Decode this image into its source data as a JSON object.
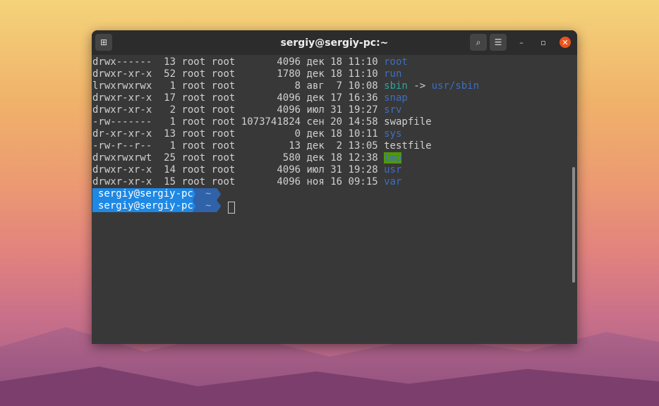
{
  "window": {
    "title": "sergiy@sergiy-pc:~"
  },
  "listing": [
    {
      "perms": "drwx------",
      "links": "13",
      "owner": "root",
      "group": "root",
      "size": "4096",
      "month": "дек",
      "day": "18",
      "time": "11:10",
      "name": "root",
      "type": "dir"
    },
    {
      "perms": "drwxr-xr-x",
      "links": "52",
      "owner": "root",
      "group": "root",
      "size": "1780",
      "month": "дек",
      "day": "18",
      "time": "11:10",
      "name": "run",
      "type": "dir"
    },
    {
      "perms": "lrwxrwxrwx",
      "links": "1",
      "owner": "root",
      "group": "root",
      "size": "8",
      "month": "авг",
      "day": "7",
      "time": "10:08",
      "name": "sbin",
      "type": "link",
      "arrow": "->",
      "target": "usr/sbin"
    },
    {
      "perms": "drwxr-xr-x",
      "links": "17",
      "owner": "root",
      "group": "root",
      "size": "4096",
      "month": "дек",
      "day": "17",
      "time": "16:36",
      "name": "snap",
      "type": "dir"
    },
    {
      "perms": "drwxr-xr-x",
      "links": "2",
      "owner": "root",
      "group": "root",
      "size": "4096",
      "month": "июл",
      "day": "31",
      "time": "19:27",
      "name": "srv",
      "type": "dir"
    },
    {
      "perms": "-rw-------",
      "links": "1",
      "owner": "root",
      "group": "root",
      "size": "1073741824",
      "month": "сен",
      "day": "20",
      "time": "14:58",
      "name": "swapfile",
      "type": "file"
    },
    {
      "perms": "dr-xr-xr-x",
      "links": "13",
      "owner": "root",
      "group": "root",
      "size": "0",
      "month": "дек",
      "day": "18",
      "time": "10:11",
      "name": "sys",
      "type": "dir"
    },
    {
      "perms": "-rw-r--r--",
      "links": "1",
      "owner": "root",
      "group": "root",
      "size": "13",
      "month": "дек",
      "day": "2",
      "time": "13:05",
      "name": "testfile",
      "type": "file"
    },
    {
      "perms": "drwxrwxrwt",
      "links": "25",
      "owner": "root",
      "group": "root",
      "size": "580",
      "month": "дек",
      "day": "18",
      "time": "12:38",
      "name": "tmp",
      "type": "tmp"
    },
    {
      "perms": "drwxr-xr-x",
      "links": "14",
      "owner": "root",
      "group": "root",
      "size": "4096",
      "month": "июл",
      "day": "31",
      "time": "19:28",
      "name": "usr",
      "type": "dir"
    },
    {
      "perms": "drwxr-xr-x",
      "links": "15",
      "owner": "root",
      "group": "root",
      "size": "4096",
      "month": "ноя",
      "day": "16",
      "time": "09:15",
      "name": "var",
      "type": "dir"
    }
  ],
  "prompts": [
    {
      "user": "sergiy@sergiy-pc",
      "dir": "~"
    },
    {
      "user": "sergiy@sergiy-pc",
      "dir": "~"
    }
  ]
}
